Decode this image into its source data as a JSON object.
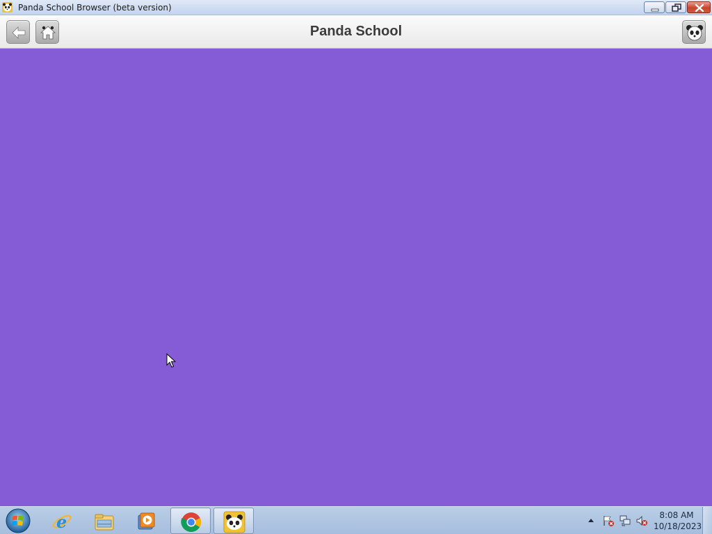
{
  "window": {
    "title": "Panda School Browser (beta version)"
  },
  "toolbar": {
    "title": "Panda School",
    "back_button": "back-arrow-icon",
    "home_button": "home-icon",
    "panda_button": "panda-icon"
  },
  "content": {
    "background_color": "#865cd6"
  },
  "taskbar": {
    "items": [
      "start-orb-icon",
      "internet-explorer-icon",
      "file-explorer-icon",
      "media-player-icon",
      "chrome-icon",
      "panda-app-icon"
    ],
    "clock": {
      "time": "8:08 AM",
      "date": "10/18/2023"
    }
  }
}
